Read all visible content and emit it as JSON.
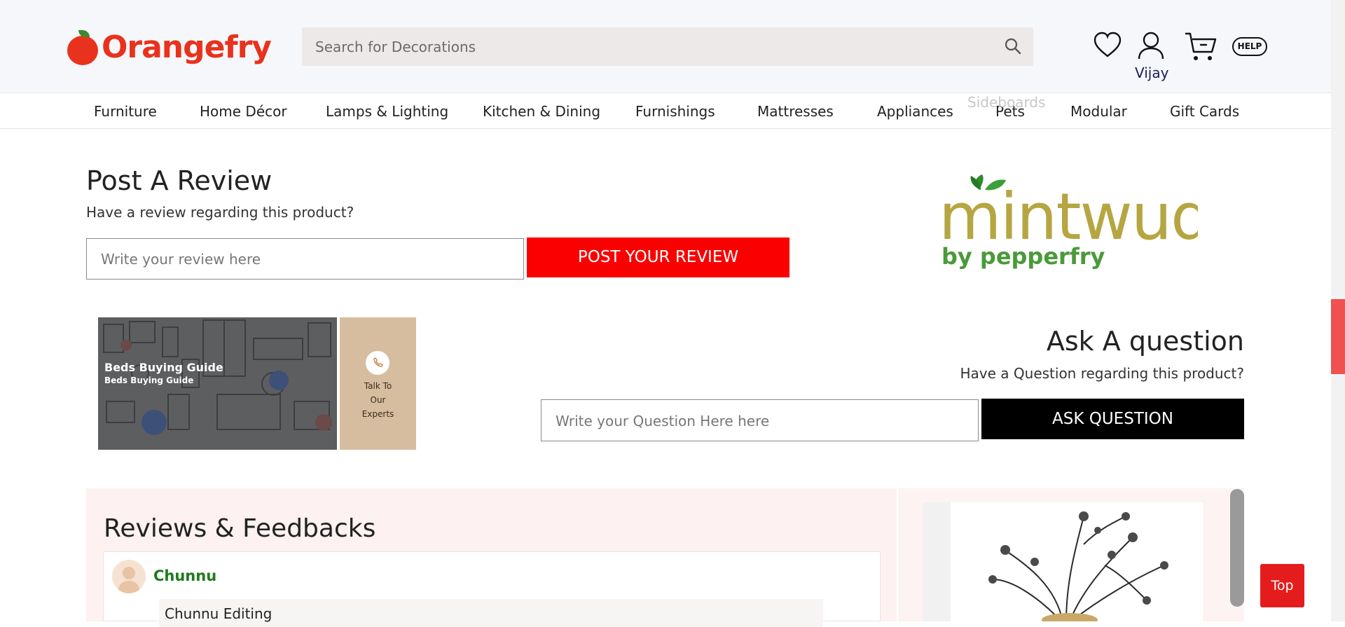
{
  "header": {
    "logo_text": "Orangefry",
    "search_placeholder": "Search for Decorations",
    "user_name": "Vijay",
    "help_label": "HELP"
  },
  "nav": {
    "items": [
      "Furniture",
      "Home Décor",
      "Lamps & Lighting",
      "Kitchen & Dining",
      "Furnishings",
      "Mattresses",
      "Appliances",
      "Pets",
      "Modular",
      "Gift Cards"
    ],
    "ghost_item": "Sideboards"
  },
  "post_review": {
    "title": "Post A Review",
    "subtitle": "Have a review regarding this product?",
    "input_placeholder": "Write your review here",
    "button_label": "POST YOUR REVIEW"
  },
  "brand": {
    "name": "mintwud",
    "tagline": "by pepperfry"
  },
  "guide": {
    "title": "Beds Buying Guide",
    "subtitle": "Beds Buying Guide",
    "expert_lines": [
      "Talk To",
      "Our",
      "Experts"
    ]
  },
  "ask_question": {
    "title": "Ask A question",
    "subtitle": "Have a Question regarding this product?",
    "input_placeholder": "Write your Question Here here",
    "button_label": "ASK QUESTION"
  },
  "reviews": {
    "title": "Reviews & Feedbacks",
    "items": [
      {
        "name": "Chunnu",
        "text": "Chunnu Editing"
      }
    ]
  },
  "top_button": "Top",
  "colors": {
    "brand_red": "#e8321d",
    "post_button": "#fb0000",
    "ask_button": "#000000",
    "reviewer_green": "#1e7a1e",
    "mintwud_olive": "#b5a642",
    "pepperfry_green": "#4a9a3a"
  }
}
